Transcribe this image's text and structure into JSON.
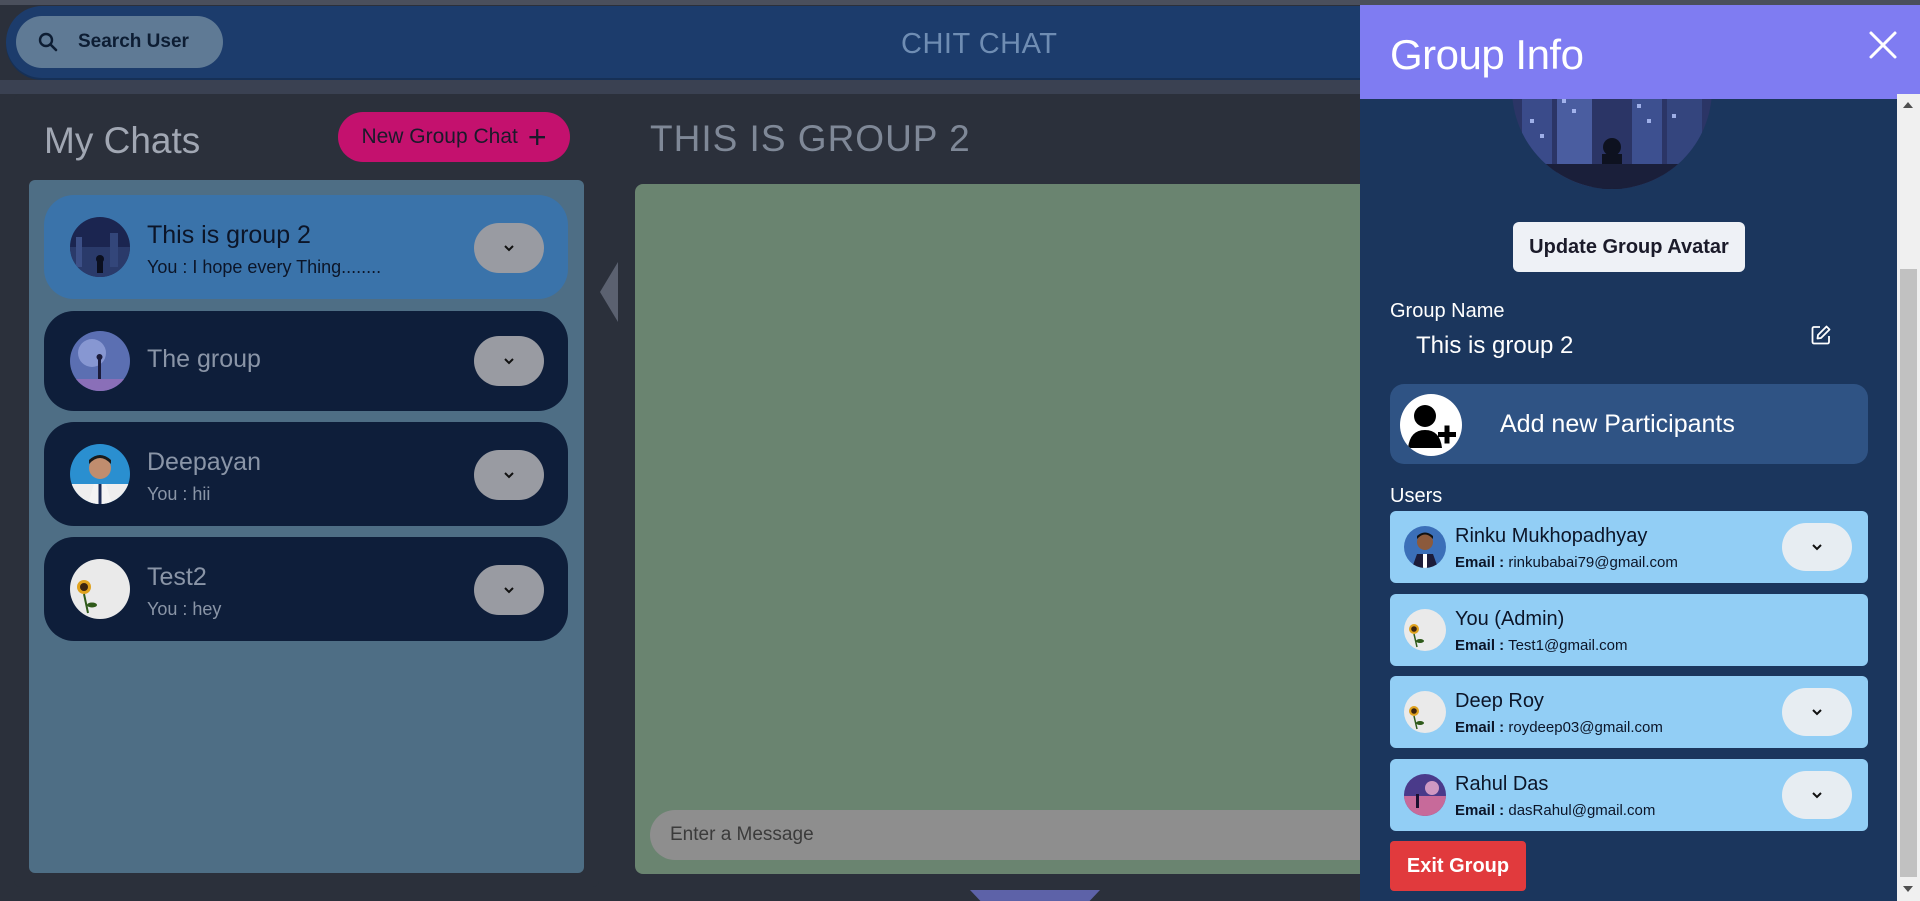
{
  "header": {
    "search_label": "Search User",
    "app_title": "CHIT CHAT"
  },
  "chats": {
    "title": "My Chats",
    "new_group_label": "New Group Chat",
    "new_group_plus": "+",
    "items": [
      {
        "name": "This is group 2",
        "preview": "You : I hope every Thing........",
        "active": true
      },
      {
        "name": "The group",
        "preview": "",
        "active": false
      },
      {
        "name": "Deepayan",
        "preview": "You : hii",
        "active": false
      },
      {
        "name": "Test2",
        "preview": "You : hey",
        "active": false
      }
    ]
  },
  "conversation": {
    "title": "THIS IS GROUP 2",
    "input_placeholder": "Enter a Message"
  },
  "group_info": {
    "title": "Group Info",
    "update_avatar_label": "Update Group Avatar",
    "group_name_label": "Group Name",
    "group_name_value": "This is group 2",
    "add_participants_label": "Add new Participants",
    "users_label": "Users",
    "email_prefix": "Email :",
    "users": [
      {
        "name": "Rinku Mukhopadhyay",
        "email": "rinkubabai79@gmail.com"
      },
      {
        "name": "You (Admin)",
        "email": "Test1@gmail.com"
      },
      {
        "name": "Deep Roy",
        "email": "roydeep03@gmail.com"
      },
      {
        "name": "Rahul Das",
        "email": "dasRahul@gmail.com"
      }
    ],
    "exit_label": "Exit Group"
  },
  "colors": {
    "header_bg": "#1c3c6c",
    "drawer_header_bg": "#7f7cf2",
    "drawer_bg": "#1b365d",
    "new_group_btn": "#c4116e",
    "exit_btn": "#e13a3d",
    "user_card": "#92cef5",
    "active_chat": "#3a73aa"
  }
}
